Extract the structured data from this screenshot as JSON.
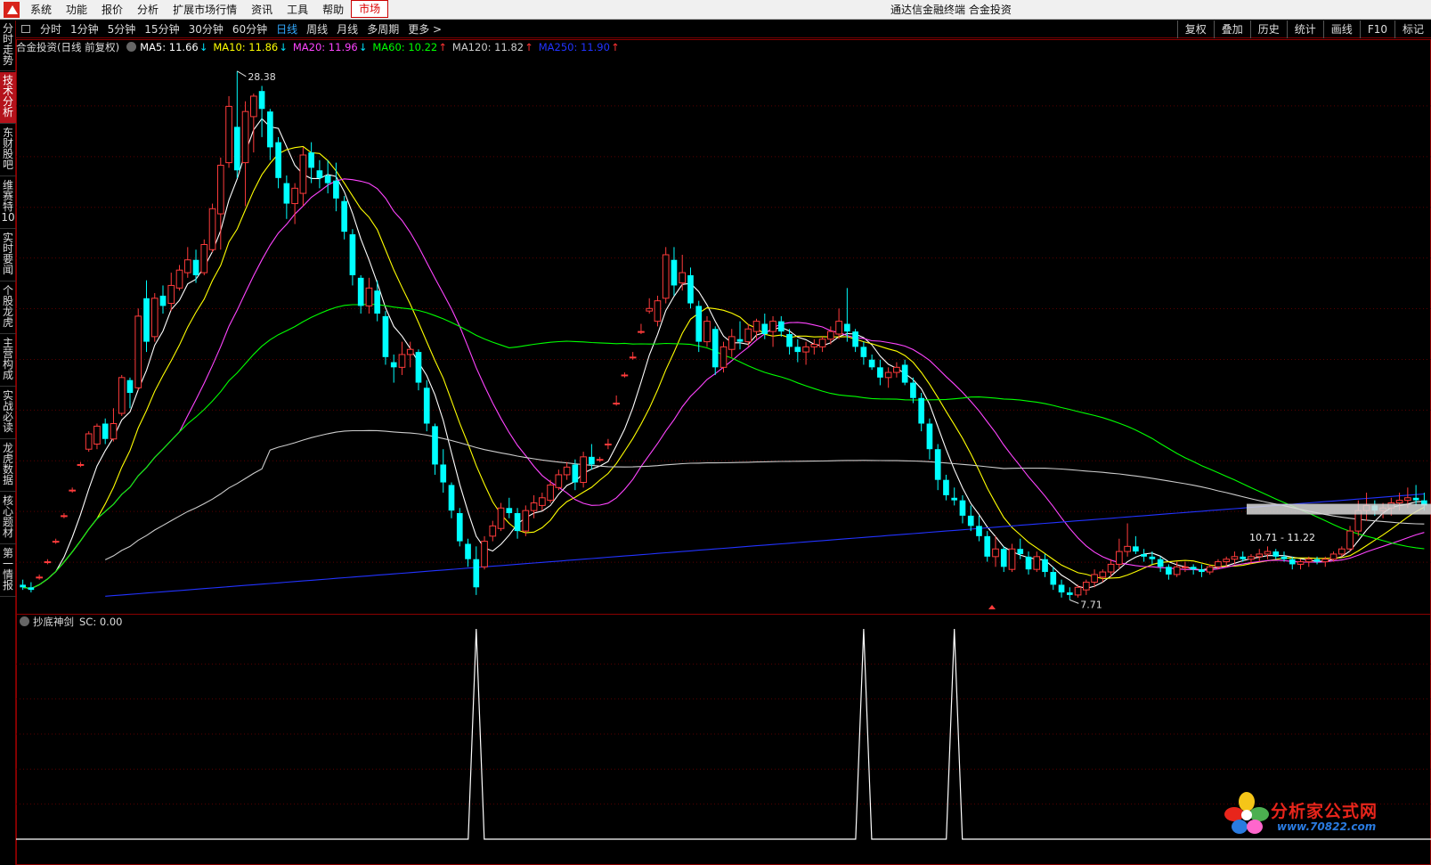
{
  "menu": {
    "items": [
      "系统",
      "功能",
      "报价",
      "分析",
      "扩展市场行情",
      "资讯",
      "工具",
      "帮助",
      "市场"
    ],
    "active_index": 8,
    "window_title": "通达信金融终端  合金投资"
  },
  "toolbar": {
    "periods": [
      "分时",
      "1分钟",
      "5分钟",
      "15分钟",
      "30分钟",
      "60分钟",
      "日线",
      "周线",
      "月线",
      "多周期",
      "更多 >"
    ],
    "active_index": 6,
    "right_buttons": [
      "复权",
      "叠加",
      "历史",
      "统计",
      "画线",
      "F10",
      "标记"
    ]
  },
  "left_tabs": [
    {
      "label": "分时走势",
      "active": false
    },
    {
      "label": "技术分析",
      "active": true
    },
    {
      "label": "东财股吧",
      "active": false
    },
    {
      "label": "维赛特10",
      "active": false
    },
    {
      "label": "实时要闻",
      "active": false
    },
    {
      "label": "个股龙虎",
      "active": false
    },
    {
      "label": "主营构成",
      "active": false
    },
    {
      "label": "实战必读",
      "active": false
    },
    {
      "label": "龙虎数据",
      "active": false
    },
    {
      "label": "核心题材",
      "active": false
    },
    {
      "label": "第一情报",
      "active": false
    }
  ],
  "main_indicator": {
    "stock": "合金投资(日线 前复权)",
    "ma": [
      {
        "label": "MA5: 11.66",
        "arrow": "↓",
        "color": "#ffffff",
        "arrow_color": "#00e5ff"
      },
      {
        "label": "MA10: 11.86",
        "arrow": "↓",
        "color": "#ffff00",
        "arrow_color": "#00e5ff"
      },
      {
        "label": "MA20: 11.96",
        "arrow": "↓",
        "color": "#ff44ff",
        "arrow_color": "#00e5ff"
      },
      {
        "label": "MA60: 10.22",
        "arrow": "↑",
        "color": "#00ff00",
        "arrow_color": "#ff3333"
      },
      {
        "label": "MA120: 11.82",
        "arrow": "↑",
        "color": "#cccccc",
        "arrow_color": "#ff3333"
      },
      {
        "label": "MA250: 11.90",
        "arrow": "↑",
        "color": "#2233ff",
        "arrow_color": "#ff3333"
      }
    ],
    "high_label": "28.38",
    "low_label": "7.71",
    "range_label": "10.71 - 11.22"
  },
  "sub_indicator": {
    "name": "抄底神剑",
    "value": "SC: 0.00"
  },
  "colors": {
    "up": "#ff3b3b",
    "down": "#00ffff",
    "grid": "#5a0000",
    "border": "#8b0000"
  },
  "chart_data": {
    "type": "candlestick",
    "candles": [
      [
        8.3,
        8.5,
        8.1,
        8.2
      ],
      [
        8.2,
        8.4,
        8.0,
        8.1
      ],
      [
        8.6,
        8.7,
        8.5,
        8.6
      ],
      [
        9.2,
        9.3,
        9.1,
        9.2
      ],
      [
        10.0,
        10.1,
        9.9,
        10.0
      ],
      [
        11.0,
        11.1,
        10.9,
        11.0
      ],
      [
        12.0,
        12.1,
        11.9,
        12.0
      ],
      [
        13.0,
        13.1,
        12.9,
        13.0
      ],
      [
        13.6,
        14.3,
        13.5,
        14.2
      ],
      [
        13.8,
        14.6,
        13.6,
        14.5
      ],
      [
        14.6,
        14.8,
        13.8,
        14.0
      ],
      [
        14.0,
        15.2,
        13.9,
        14.6
      ],
      [
        15.0,
        16.5,
        14.9,
        16.4
      ],
      [
        16.3,
        16.4,
        15.2,
        15.8
      ],
      [
        16.0,
        19.1,
        15.9,
        18.8
      ],
      [
        19.5,
        20.2,
        17.4,
        17.8
      ],
      [
        18.0,
        19.7,
        17.8,
        19.5
      ],
      [
        19.6,
        20.0,
        18.9,
        19.2
      ],
      [
        19.3,
        20.5,
        19.0,
        20.0
      ],
      [
        19.9,
        20.8,
        19.8,
        20.6
      ],
      [
        20.5,
        21.5,
        20.3,
        21.0
      ],
      [
        21.0,
        21.4,
        20.1,
        20.4
      ],
      [
        20.5,
        21.8,
        20.4,
        21.6
      ],
      [
        21.4,
        23.2,
        21.3,
        23.0
      ],
      [
        22.8,
        25.0,
        21.4,
        24.7
      ],
      [
        24.8,
        27.4,
        24.6,
        27.0
      ],
      [
        26.2,
        28.38,
        24.2,
        24.5
      ],
      [
        24.8,
        27.2,
        23.1,
        26.8
      ],
      [
        26.6,
        27.5,
        25.2,
        27.4
      ],
      [
        27.6,
        27.8,
        25.8,
        26.9
      ],
      [
        26.8,
        26.9,
        24.9,
        25.4
      ],
      [
        25.6,
        25.8,
        23.8,
        24.2
      ],
      [
        24.0,
        24.3,
        22.6,
        23.2
      ],
      [
        23.2,
        24.0,
        22.4,
        23.8
      ],
      [
        23.6,
        25.4,
        23.1,
        25.1
      ],
      [
        25.2,
        25.6,
        24.0,
        24.6
      ],
      [
        24.5,
        24.9,
        23.8,
        24.2
      ],
      [
        24.3,
        24.9,
        23.6,
        24.0
      ],
      [
        24.1,
        24.8,
        22.9,
        23.4
      ],
      [
        23.3,
        23.5,
        21.8,
        22.1
      ],
      [
        22.0,
        22.2,
        20.0,
        20.4
      ],
      [
        20.3,
        20.4,
        18.9,
        19.2
      ],
      [
        19.2,
        20.3,
        18.9,
        19.9
      ],
      [
        19.8,
        20.2,
        18.6,
        18.9
      ],
      [
        18.8,
        19.0,
        16.9,
        17.2
      ],
      [
        17.0,
        17.3,
        16.2,
        16.8
      ],
      [
        16.8,
        17.8,
        16.5,
        17.3
      ],
      [
        17.3,
        17.8,
        16.8,
        17.5
      ],
      [
        17.4,
        17.5,
        15.9,
        16.2
      ],
      [
        16.0,
        16.3,
        14.3,
        14.6
      ],
      [
        14.5,
        14.6,
        12.6,
        13.0
      ],
      [
        13.0,
        13.6,
        11.9,
        12.3
      ],
      [
        12.2,
        12.3,
        10.9,
        11.2
      ],
      [
        11.1,
        11.3,
        9.8,
        10.0
      ],
      [
        9.9,
        10.1,
        9.0,
        9.3
      ],
      [
        9.3,
        9.8,
        7.9,
        8.2
      ],
      [
        9.0,
        10.2,
        8.9,
        10.0
      ],
      [
        10.2,
        10.8,
        10.0,
        10.6
      ],
      [
        10.5,
        11.5,
        10.4,
        11.3
      ],
      [
        11.3,
        11.7,
        10.9,
        11.1
      ],
      [
        11.1,
        11.3,
        10.1,
        10.4
      ],
      [
        10.4,
        11.4,
        10.2,
        11.2
      ],
      [
        11.2,
        11.8,
        10.9,
        11.5
      ],
      [
        11.4,
        11.9,
        11.2,
        11.7
      ],
      [
        11.6,
        12.4,
        11.5,
        12.2
      ],
      [
        12.1,
        12.8,
        12.0,
        12.6
      ],
      [
        12.6,
        13.1,
        12.4,
        12.9
      ],
      [
        13.0,
        13.2,
        12.0,
        12.3
      ],
      [
        12.3,
        13.5,
        12.1,
        13.3
      ],
      [
        13.3,
        13.8,
        12.8,
        13.0
      ],
      [
        13.2,
        13.3,
        13.1,
        13.2
      ],
      [
        13.8,
        14.0,
        13.6,
        13.8
      ],
      [
        15.4,
        15.7,
        15.3,
        15.4
      ],
      [
        16.5,
        16.6,
        16.4,
        16.5
      ],
      [
        17.2,
        17.4,
        17.1,
        17.2
      ],
      [
        18.2,
        18.5,
        18.1,
        18.2
      ],
      [
        19.0,
        19.5,
        18.9,
        19.1
      ],
      [
        18.6,
        19.6,
        18.4,
        19.4
      ],
      [
        19.5,
        21.5,
        19.3,
        21.2
      ],
      [
        21.0,
        21.5,
        19.6,
        20.0
      ],
      [
        20.1,
        21.2,
        19.8,
        20.5
      ],
      [
        20.4,
        20.7,
        19.1,
        19.3
      ],
      [
        19.2,
        19.4,
        17.4,
        17.8
      ],
      [
        17.8,
        18.8,
        17.6,
        18.6
      ],
      [
        18.3,
        18.4,
        16.5,
        16.8
      ],
      [
        16.8,
        17.8,
        16.6,
        17.6
      ],
      [
        17.5,
        18.3,
        17.2,
        18.0
      ],
      [
        17.9,
        18.6,
        17.5,
        17.8
      ],
      [
        17.8,
        18.5,
        17.6,
        18.3
      ],
      [
        18.2,
        18.7,
        17.9,
        18.6
      ],
      [
        18.5,
        18.9,
        17.9,
        18.1
      ],
      [
        18.2,
        18.8,
        17.6,
        18.6
      ],
      [
        18.6,
        18.8,
        18.0,
        18.2
      ],
      [
        18.1,
        18.3,
        17.3,
        17.6
      ],
      [
        17.6,
        17.9,
        17.0,
        17.4
      ],
      [
        17.4,
        17.8,
        16.9,
        17.6
      ],
      [
        17.6,
        17.9,
        17.3,
        17.7
      ],
      [
        17.6,
        18.0,
        17.4,
        17.9
      ],
      [
        17.9,
        18.4,
        17.7,
        18.2
      ],
      [
        18.1,
        19.1,
        17.9,
        18.6
      ],
      [
        18.5,
        19.9,
        17.8,
        18.2
      ],
      [
        18.2,
        18.3,
        17.4,
        17.6
      ],
      [
        17.6,
        17.8,
        16.9,
        17.2
      ],
      [
        17.1,
        17.3,
        16.7,
        16.8
      ],
      [
        16.8,
        17.1,
        16.1,
        16.4
      ],
      [
        16.4,
        16.8,
        16.0,
        16.6
      ],
      [
        16.6,
        17.0,
        16.4,
        16.8
      ],
      [
        16.9,
        17.1,
        16.1,
        16.2
      ],
      [
        16.2,
        16.4,
        15.4,
        15.6
      ],
      [
        15.6,
        15.8,
        14.3,
        14.6
      ],
      [
        14.6,
        14.8,
        13.2,
        13.6
      ],
      [
        13.6,
        13.8,
        12.0,
        12.4
      ],
      [
        12.4,
        12.6,
        11.6,
        11.8
      ],
      [
        11.7,
        12.1,
        11.4,
        11.6
      ],
      [
        11.6,
        11.8,
        10.7,
        11.0
      ],
      [
        11.0,
        11.4,
        10.4,
        10.6
      ],
      [
        10.6,
        11.0,
        10.0,
        10.2
      ],
      [
        10.2,
        10.4,
        9.2,
        9.4
      ],
      [
        9.4,
        10.2,
        9.0,
        9.7
      ],
      [
        9.7,
        9.8,
        8.8,
        9.0
      ],
      [
        8.9,
        9.9,
        8.8,
        9.7
      ],
      [
        9.7,
        10.1,
        9.3,
        9.5
      ],
      [
        9.4,
        9.6,
        8.7,
        8.9
      ],
      [
        8.9,
        9.6,
        8.8,
        9.4
      ],
      [
        9.3,
        9.5,
        8.6,
        8.8
      ],
      [
        8.8,
        9.0,
        8.1,
        8.3
      ],
      [
        8.3,
        8.5,
        7.8,
        8.0
      ],
      [
        8.0,
        8.2,
        7.71,
        7.9
      ],
      [
        7.9,
        8.3,
        7.8,
        8.2
      ],
      [
        8.1,
        8.5,
        7.9,
        8.4
      ],
      [
        8.4,
        8.9,
        8.2,
        8.7
      ],
      [
        8.6,
        8.9,
        8.4,
        8.8
      ],
      [
        8.8,
        9.3,
        8.6,
        9.1
      ],
      [
        9.1,
        10.1,
        8.9,
        9.6
      ],
      [
        9.6,
        10.7,
        9.4,
        9.8
      ],
      [
        9.8,
        10.2,
        9.5,
        9.6
      ],
      [
        9.5,
        9.7,
        9.2,
        9.4
      ],
      [
        9.4,
        9.6,
        9.1,
        9.3
      ],
      [
        9.3,
        9.4,
        8.8,
        9.0
      ],
      [
        9.0,
        9.1,
        8.5,
        8.7
      ],
      [
        8.7,
        9.2,
        8.6,
        9.0
      ],
      [
        9.0,
        9.2,
        8.8,
        9.0
      ],
      [
        9.0,
        9.1,
        8.7,
        8.9
      ],
      [
        8.9,
        9.1,
        8.6,
        8.8
      ],
      [
        8.8,
        9.1,
        8.7,
        9.0
      ],
      [
        9.0,
        9.3,
        8.9,
        9.2
      ],
      [
        9.2,
        9.4,
        9.0,
        9.3
      ],
      [
        9.3,
        9.6,
        9.1,
        9.4
      ],
      [
        9.4,
        9.6,
        9.2,
        9.3
      ],
      [
        9.3,
        9.5,
        9.1,
        9.4
      ],
      [
        9.4,
        9.7,
        9.2,
        9.5
      ],
      [
        9.5,
        9.8,
        9.3,
        9.6
      ],
      [
        9.6,
        9.7,
        9.3,
        9.4
      ],
      [
        9.4,
        9.6,
        9.2,
        9.3
      ],
      [
        9.3,
        9.4,
        8.9,
        9.1
      ],
      [
        9.1,
        9.3,
        8.9,
        9.2
      ],
      [
        9.2,
        9.4,
        9.0,
        9.3
      ],
      [
        9.3,
        9.4,
        9.1,
        9.2
      ],
      [
        9.2,
        9.4,
        9.0,
        9.3
      ],
      [
        9.3,
        9.6,
        9.2,
        9.5
      ],
      [
        9.5,
        9.8,
        9.4,
        9.7
      ],
      [
        9.7,
        10.6,
        9.6,
        10.4
      ],
      [
        10.4,
        11.6,
        10.2,
        11.2
      ],
      [
        11.2,
        11.9,
        10.8,
        11.4
      ],
      [
        11.4,
        11.6,
        11.0,
        11.2
      ],
      [
        11.2,
        11.5,
        10.9,
        11.3
      ],
      [
        11.3,
        11.7,
        11.0,
        11.5
      ],
      [
        11.5,
        11.9,
        11.2,
        11.6
      ],
      [
        11.6,
        12.1,
        11.3,
        11.7
      ],
      [
        11.7,
        12.2,
        11.4,
        11.6
      ],
      [
        11.6,
        11.9,
        11.2,
        11.4
      ]
    ],
    "ylim": [
      7.2,
      29.0
    ]
  },
  "sub_chart_data": {
    "type": "spike",
    "spike_indices": [
      55,
      102,
      113
    ],
    "ylim": [
      0,
      1
    ]
  }
}
